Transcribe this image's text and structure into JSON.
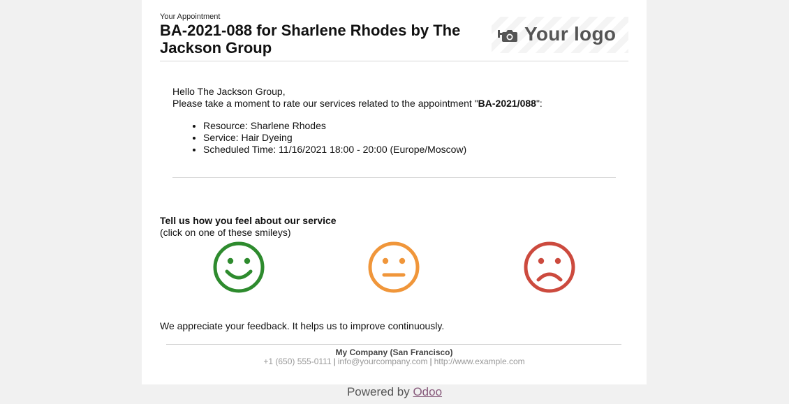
{
  "header": {
    "label": "Your Appointment",
    "title": "BA-2021-088 for Sharlene Rhodes by The Jackson Group",
    "logo_text": "Your logo"
  },
  "greeting": {
    "hello": "Hello The Jackson Group,",
    "prompt_prefix": "Please take a moment to rate our services related to the appointment \"",
    "appointment_ref": "BA-2021/088",
    "prompt_suffix": "\":"
  },
  "details": [
    "Resource: Sharlene Rhodes",
    "Service: Hair Dyeing",
    "Scheduled Time: 11/16/2021 18:00 - 20:00 (Europe/Moscow)"
  ],
  "rating": {
    "title": "Tell us how you feel about our service",
    "subtitle": "(click on one of these smileys)",
    "options": [
      {
        "name": "satisfied",
        "color": "#2e8b2e"
      },
      {
        "name": "neutral",
        "color": "#f0963a"
      },
      {
        "name": "dissatisfied",
        "color": "#cc4a3e"
      }
    ]
  },
  "feedback_note": "We appreciate your feedback. It helps us to improve continuously.",
  "footer": {
    "company": "My Company (San Francisco)",
    "phone": "+1 (650) 555-0111",
    "email": "info@yourcompany.com",
    "website": "http://www.example.com"
  },
  "powered": {
    "prefix": "Powered by ",
    "link": "Odoo",
    "link_color": "#875a7b"
  },
  "icons": {
    "logo": "camera-plus-icon",
    "smileys": [
      "smiley-happy-icon",
      "smiley-neutral-icon",
      "smiley-sad-icon"
    ]
  }
}
